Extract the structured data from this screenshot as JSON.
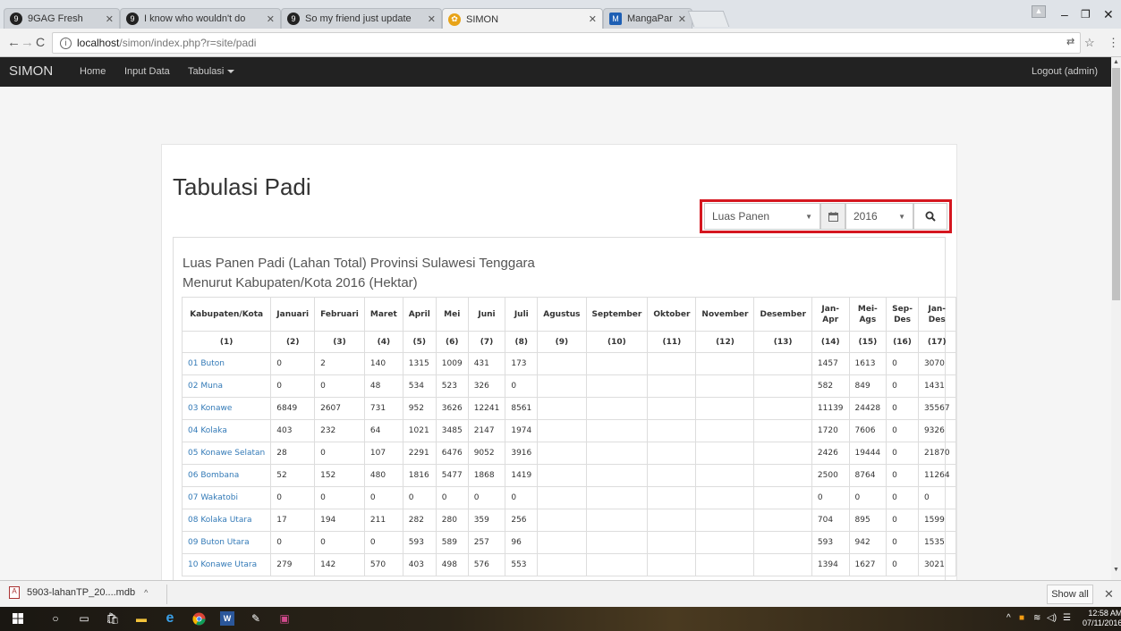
{
  "browser": {
    "tabs": [
      {
        "title": "9GAG Fresh",
        "icon": "9gag-icon",
        "active": false
      },
      {
        "title": "I know who wouldn't do",
        "icon": "9gag-icon",
        "active": false
      },
      {
        "title": "So my friend just update",
        "icon": "9gag-icon",
        "active": false
      },
      {
        "title": "SIMON",
        "icon": "simon-icon",
        "active": true
      },
      {
        "title": "MangaPark : Read Free M",
        "icon": "mangapark-icon",
        "active": false
      }
    ],
    "url_host": "localhost",
    "url_path": "/simon/index.php?r=site/padi"
  },
  "navbar": {
    "brand": "SIMON",
    "home": "Home",
    "input_data": "Input Data",
    "tabulasi": "Tabulasi",
    "logout": "Logout (admin)"
  },
  "page": {
    "title": "Tabulasi Padi",
    "filter": {
      "type_value": "Luas Panen",
      "year_value": "2016"
    },
    "panel_title_line1": "Luas Panen Padi (Lahan Total) Provinsi Sulawesi Tenggara",
    "panel_title_line2": "Menurut Kabupaten/Kota 2016 (Hektar)"
  },
  "table": {
    "headers": [
      "Kabupaten/Kota",
      "Januari",
      "Februari",
      "Maret",
      "April",
      "Mei",
      "Juni",
      "Juli",
      "Agustus",
      "September",
      "Oktober",
      "November",
      "Desember",
      "Jan-Apr",
      "Mei-Ags",
      "Sep-Des",
      "Jan-Des"
    ],
    "numbers": [
      "(1)",
      "(2)",
      "(3)",
      "(4)",
      "(5)",
      "(6)",
      "(7)",
      "(8)",
      "(9)",
      "(10)",
      "(11)",
      "(12)",
      "(13)",
      "(14)",
      "(15)",
      "(16)",
      "(17)"
    ],
    "rows": [
      [
        "01 Buton",
        "0",
        "2",
        "140",
        "1315",
        "1009",
        "431",
        "173",
        "",
        "",
        "",
        "",
        "",
        "1457",
        "1613",
        "0",
        "3070"
      ],
      [
        "02 Muna",
        "0",
        "0",
        "48",
        "534",
        "523",
        "326",
        "0",
        "",
        "",
        "",
        "",
        "",
        "582",
        "849",
        "0",
        "1431"
      ],
      [
        "03 Konawe",
        "6849",
        "2607",
        "731",
        "952",
        "3626",
        "12241",
        "8561",
        "",
        "",
        "",
        "",
        "",
        "11139",
        "24428",
        "0",
        "35567"
      ],
      [
        "04 Kolaka",
        "403",
        "232",
        "64",
        "1021",
        "3485",
        "2147",
        "1974",
        "",
        "",
        "",
        "",
        "",
        "1720",
        "7606",
        "0",
        "9326"
      ],
      [
        "05 Konawe Selatan",
        "28",
        "0",
        "107",
        "2291",
        "6476",
        "9052",
        "3916",
        "",
        "",
        "",
        "",
        "",
        "2426",
        "19444",
        "0",
        "21870"
      ],
      [
        "06 Bombana",
        "52",
        "152",
        "480",
        "1816",
        "5477",
        "1868",
        "1419",
        "",
        "",
        "",
        "",
        "",
        "2500",
        "8764",
        "0",
        "11264"
      ],
      [
        "07 Wakatobi",
        "0",
        "0",
        "0",
        "0",
        "0",
        "0",
        "0",
        "",
        "",
        "",
        "",
        "",
        "0",
        "0",
        "0",
        "0"
      ],
      [
        "08 Kolaka Utara",
        "17",
        "194",
        "211",
        "282",
        "280",
        "359",
        "256",
        "",
        "",
        "",
        "",
        "",
        "704",
        "895",
        "0",
        "1599"
      ],
      [
        "09 Buton Utara",
        "0",
        "0",
        "0",
        "593",
        "589",
        "257",
        "96",
        "",
        "",
        "",
        "",
        "",
        "593",
        "942",
        "0",
        "1535"
      ],
      [
        "10 Konawe Utara",
        "279",
        "142",
        "570",
        "403",
        "498",
        "576",
        "553",
        "",
        "",
        "",
        "",
        "",
        "1394",
        "1627",
        "0",
        "3021"
      ]
    ]
  },
  "downloads": {
    "file": "5903-lahanTP_20....mdb",
    "show_all": "Show all"
  },
  "taskbar": {
    "time": "12:58 AM",
    "date": "07/11/2016"
  },
  "colors": {
    "navbar_bg": "#222222",
    "link": "#337ab7",
    "highlight": "#d5161f"
  }
}
